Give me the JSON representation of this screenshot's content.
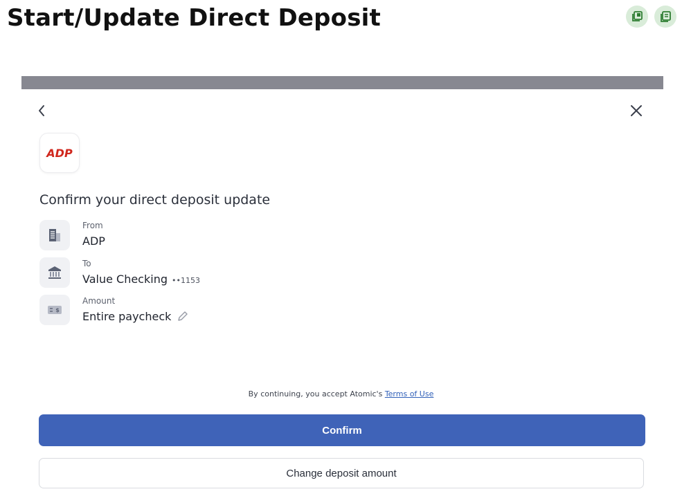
{
  "page": {
    "title": "Start/Update Direct Deposit"
  },
  "header_actions": [
    {
      "icon": "copy-icon"
    },
    {
      "icon": "notes-icon"
    }
  ],
  "progress": {
    "value": 1.0
  },
  "logo": {
    "text": "ADP",
    "color": "#d0271d"
  },
  "heading": "Confirm your direct deposit update",
  "rows": {
    "from": {
      "label": "From",
      "value": "ADP",
      "icon": "building-icon"
    },
    "to": {
      "label": "To",
      "value": "Value Checking",
      "mask": "••1153",
      "icon": "bank-icon"
    },
    "amount": {
      "label": "Amount",
      "value": "Entire paycheck",
      "icon": "money-icon"
    }
  },
  "terms": {
    "prefix": "By continuing, you accept Atomic's",
    "link": "Terms of Use"
  },
  "buttons": {
    "confirm": "Confirm",
    "change": "Change deposit amount"
  },
  "colors": {
    "primary": "#3f63b8",
    "header_icon_bg": "#d9ecd9",
    "header_icon": "#2e7d32",
    "progress": "#878891"
  }
}
